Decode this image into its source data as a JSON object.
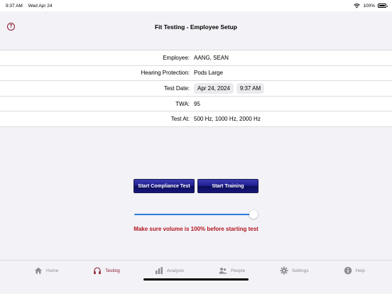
{
  "status_bar": {
    "time": "9:37 AM",
    "date": "Wed Apr 24",
    "battery": "100%"
  },
  "nav": {
    "help_glyph": "?",
    "title": "Fit Testing - Employee Setup"
  },
  "form": {
    "employee_label": "Employee:",
    "employee_value": "AANG, SEAN",
    "hearing_label": "Hearing Protection:",
    "hearing_value": "Pods Large",
    "test_date_label": "Test Date:",
    "test_date_value": "Apr 24, 2024",
    "test_time_value": "9:37 AM",
    "twa_label": "TWA:",
    "twa_value": "95",
    "test_at_label": "Test At:",
    "test_at_value": "500 Hz, 1000 Hz, 2000 Hz"
  },
  "actions": {
    "compliance_label": "Start Compliance Test",
    "training_label": "Start Training"
  },
  "volume": {
    "level": 1.0,
    "warning": "Make sure volume is 100% before starting test"
  },
  "tabs": [
    {
      "label": "Home",
      "icon": "home-icon",
      "active": false
    },
    {
      "label": "Testing",
      "icon": "headphones-icon",
      "active": true
    },
    {
      "label": "Analysis",
      "icon": "bar-chart-icon",
      "active": false
    },
    {
      "label": "People",
      "icon": "people-icon",
      "active": false
    },
    {
      "label": "Settings",
      "icon": "gear-icon",
      "active": false
    },
    {
      "label": "Help",
      "icon": "info-icon",
      "active": false
    }
  ],
  "colors": {
    "accent": "#8b1a2b",
    "warning": "#b3151e",
    "slider": "#2b7de0",
    "button": "#1d1d8a"
  }
}
